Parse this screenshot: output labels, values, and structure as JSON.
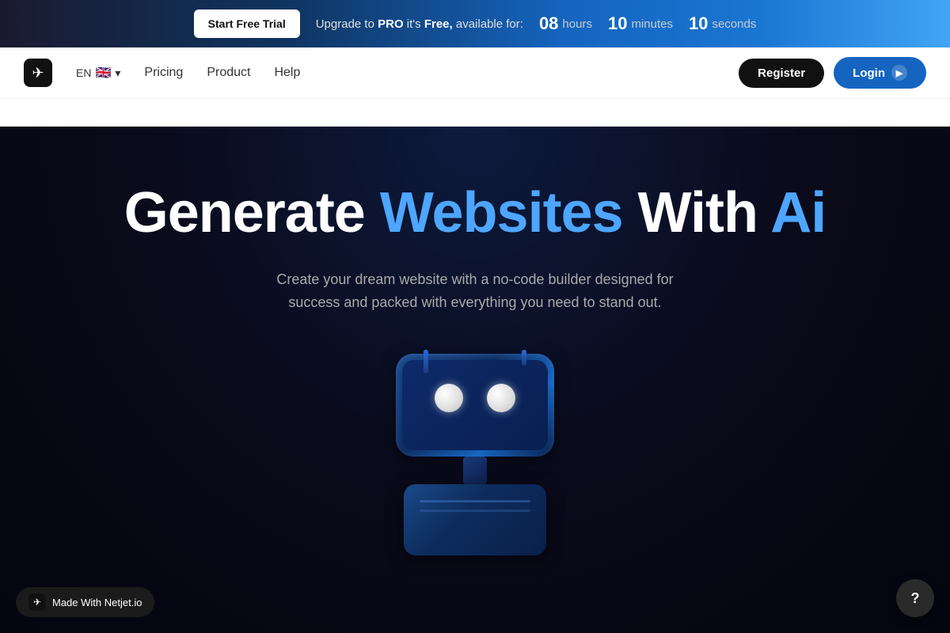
{
  "banner": {
    "trial_button": "Start Free Trial",
    "upgrade_prefix": "Upgrade to",
    "pro": "PRO",
    "its": "it's",
    "free": "Free,",
    "available": "available for:",
    "hours_num": "08",
    "hours_label": "hours",
    "minutes_num": "10",
    "minutes_label": "minutes",
    "seconds_num": "10",
    "seconds_label": "seconds"
  },
  "nav": {
    "logo_icon": "✈",
    "lang": "EN",
    "flag": "🇬🇧",
    "links": [
      {
        "label": "Pricing",
        "id": "pricing"
      },
      {
        "label": "Product",
        "id": "product"
      },
      {
        "label": "Help",
        "id": "help"
      }
    ],
    "register": "Register",
    "login": "Login"
  },
  "hero": {
    "title_start": "Generate",
    "title_blue": "Websites",
    "title_end": "With",
    "title_ai": "Ai",
    "subtitle": "Create your dream website with a no-code builder designed for success and packed with everything you need to stand out."
  },
  "footer": {
    "netjet_badge": "Made With Netjet.io",
    "help_icon": "?"
  }
}
